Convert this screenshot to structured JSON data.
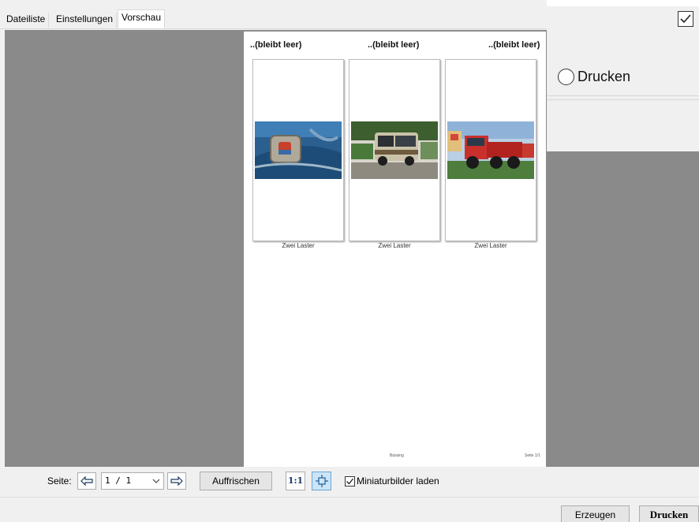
{
  "tabs": [
    {
      "label": "Dateiliste",
      "active": false
    },
    {
      "label": "Einstellungen",
      "active": false
    },
    {
      "label": "Vorschau",
      "active": true
    }
  ],
  "right_panel": {
    "checkbox_checked": true,
    "radio_label": "Drucken",
    "radio_selected": false
  },
  "preview": {
    "columns": [
      {
        "title": "..(bleibt leer)",
        "caption": "Zwei Laster",
        "image": "car-emblem-photo"
      },
      {
        "title": "..(bleibt leer)",
        "caption": "Zwei Laster",
        "image": "bus-photo"
      },
      {
        "title": "..(bleibt leer)",
        "caption": "Zwei Laster",
        "image": "red-truck-photo"
      }
    ],
    "footer_left": "Büssing",
    "footer_right": "Seite 1/1"
  },
  "toolbar": {
    "page_label": "Seite:",
    "page_value": "1 / 1",
    "prev_icon": "arrow-left-icon",
    "next_icon": "arrow-right-icon",
    "refresh_label": "Auffrischen",
    "zoom_1to1_label": "1:1",
    "fit_icon": "fit-page-icon",
    "thumbnails_label": "Miniaturbilder laden",
    "thumbnails_checked": true
  },
  "bottom": {
    "generate_label": "Erzeugen",
    "print_label": "Drucken"
  },
  "colors": {
    "preview_bg": "#8a8a8a",
    "window_bg": "#f0f0f0",
    "fit_button_bg": "#cce4f7"
  }
}
